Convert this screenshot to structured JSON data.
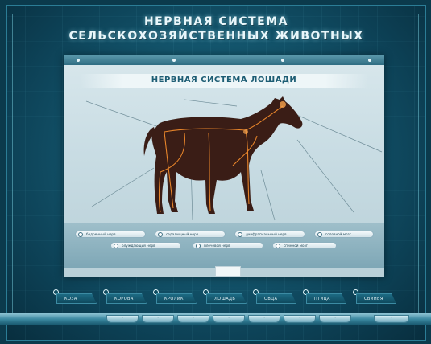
{
  "header": {
    "title_line1": "НЕРВНАЯ СИСТЕМА",
    "title_line2": "СЕЛЬСКОХОЗЯЙСТВЕННЫХ ЖИВОТНЫХ"
  },
  "panel": {
    "title": "НЕРВНАЯ СИСТЕМА ЛОШАДИ",
    "nerve_options": [
      {
        "label": "бедренный нерв"
      },
      {
        "label": "седалищный нерв"
      },
      {
        "label": "диафрагмальный нерв"
      },
      {
        "label": "головной мозг"
      },
      {
        "label": "блуждающий нерв"
      },
      {
        "label": "плечевой нерв"
      },
      {
        "label": "спинной мозг"
      }
    ]
  },
  "animals": [
    {
      "label": "КОЗА"
    },
    {
      "label": "КОРОВА"
    },
    {
      "label": "КРОЛИК"
    },
    {
      "label": "ЛОШАДЬ"
    },
    {
      "label": "ОВЦА"
    },
    {
      "label": "ПТИЦА"
    },
    {
      "label": "СВИНЬЯ"
    }
  ],
  "toolbar": {
    "buttons": [
      {
        "label": "·"
      },
      {
        "label": "·"
      },
      {
        "label": "·"
      },
      {
        "label": "·"
      },
      {
        "label": "·"
      },
      {
        "label": "·"
      },
      {
        "label": "·"
      },
      {
        "label": "·"
      }
    ]
  },
  "colors": {
    "background": "#155a72",
    "panel": "#c8dce3",
    "title_text": "#e9f7fb",
    "panel_title": "#1d5d74",
    "horse_body": "#3a1d16",
    "nerves": "#f08a2c"
  }
}
